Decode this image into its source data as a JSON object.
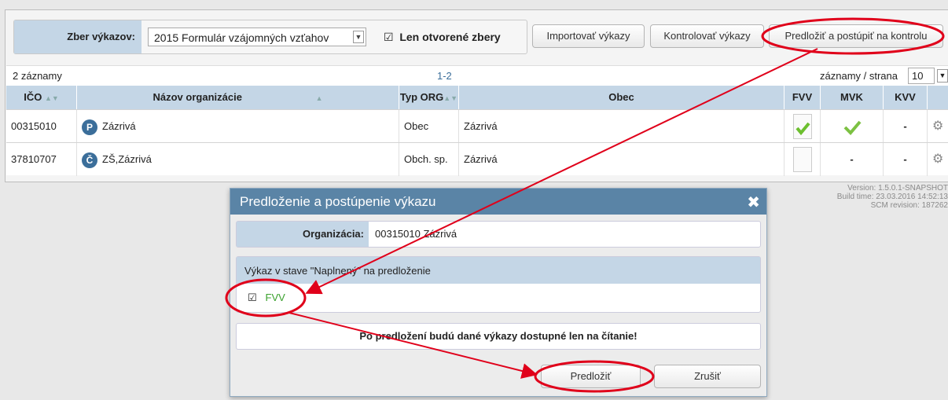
{
  "filter": {
    "label": "Zber výkazov:",
    "selected": "2015 Formulár vzájomných vzťahov",
    "open_only_label": "Len otvorené zbery"
  },
  "toolbar": {
    "import_label": "Importovať výkazy",
    "check_label": "Kontrolovať výkazy",
    "submit_label": "Predložiť a postúpiť na kontrolu"
  },
  "list": {
    "count": "2 záznamy",
    "range": "1-2",
    "per_page_label": "záznamy / strana",
    "per_page_value": "10",
    "columns": [
      "IČO",
      "Názov organizácie",
      "Typ ORG",
      "Obec",
      "FVV",
      "MVK",
      "KVV"
    ],
    "rows": [
      {
        "ico": "00315010",
        "badge": "P",
        "name": "Zázrivá",
        "type": "Obec",
        "town": "Zázrivá",
        "kvv": "-"
      },
      {
        "ico": "37810707",
        "badge": "Č",
        "name": "ZŠ,Zázrivá",
        "type": "Obch. sp.",
        "town": "Zázrivá",
        "mvk": "-",
        "kvv": "-"
      }
    ]
  },
  "meta": {
    "version": "Version: 1.5.0.1-SNAPSHOT",
    "build": "Build time: 23.03.2016 14:52:13",
    "scm": "SCM revision: 187262"
  },
  "dialog": {
    "title": "Predloženie a postúpenie výkazu",
    "org_label": "Organizácia:",
    "org_value": "00315010 Zázrivá",
    "section_title": "Výkaz v stave \"Naplnený\" na predloženie",
    "item_label": "FVV",
    "warning": "Po predložení budú dané výkazy dostupné len na čítanie!",
    "submit_label": "Predložiť",
    "cancel_label": "Zrušiť"
  },
  "colors": {
    "header_bg": "#c4d6e6",
    "dialog_title_bg": "#5a84a6",
    "annotation_red": "#e0001a",
    "ok_green": "#7cc142"
  }
}
